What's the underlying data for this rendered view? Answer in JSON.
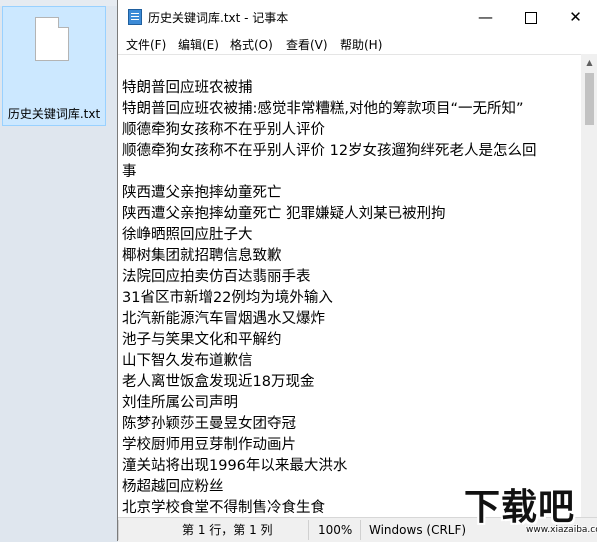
{
  "desktop": {
    "file_label": "历史关键词库.txt"
  },
  "window": {
    "title": "历史关键词库.txt - 记事本",
    "min_glyph": "—",
    "close_glyph": "✕"
  },
  "menu": [
    "文件(F)",
    "编辑(E)",
    "格式(O)",
    "查看(V)",
    "帮助(H)"
  ],
  "content_lines": [
    "特朗普回应班农被捕",
    "特朗普回应班农被捕:感觉非常糟糕,对他的筹款项目“一无所知”",
    "顺德牵狗女孩称不在乎别人评价",
    "顺德牵狗女孩称不在乎别人评价 12岁女孩遛狗绊死老人是怎么回",
    "事",
    "陕西遭父亲抱摔幼童死亡",
    "陕西遭父亲抱摔幼童死亡 犯罪嫌疑人刘某已被刑拘",
    "徐峥晒照回应肚子大",
    "椰树集团就招聘信息致歉",
    "法院回应拍卖仿百达翡丽手表",
    "31省区市新增22例均为境外输入",
    "北汽新能源汽车冒烟遇水又爆炸",
    "池子与笑果文化和平解约",
    "山下智久发布道歉信",
    "老人离世饭盒发现近18万现金",
    "刘佳所属公司声明",
    "陈梦孙颖莎王曼昱女团夺冠",
    "学校厨师用豆芽制作动画片",
    "潼关站将出现1996年以来最大洪水",
    "杨超越回应粉丝",
    "北京学校食堂不得制售冷食生食"
  ],
  "status": {
    "position": "第 1 行，第 1 列",
    "zoom": "100%",
    "line_ending": "Windows (CRLF)"
  },
  "watermark": {
    "text": "下载吧",
    "url": "www.xiazaiba.com"
  }
}
